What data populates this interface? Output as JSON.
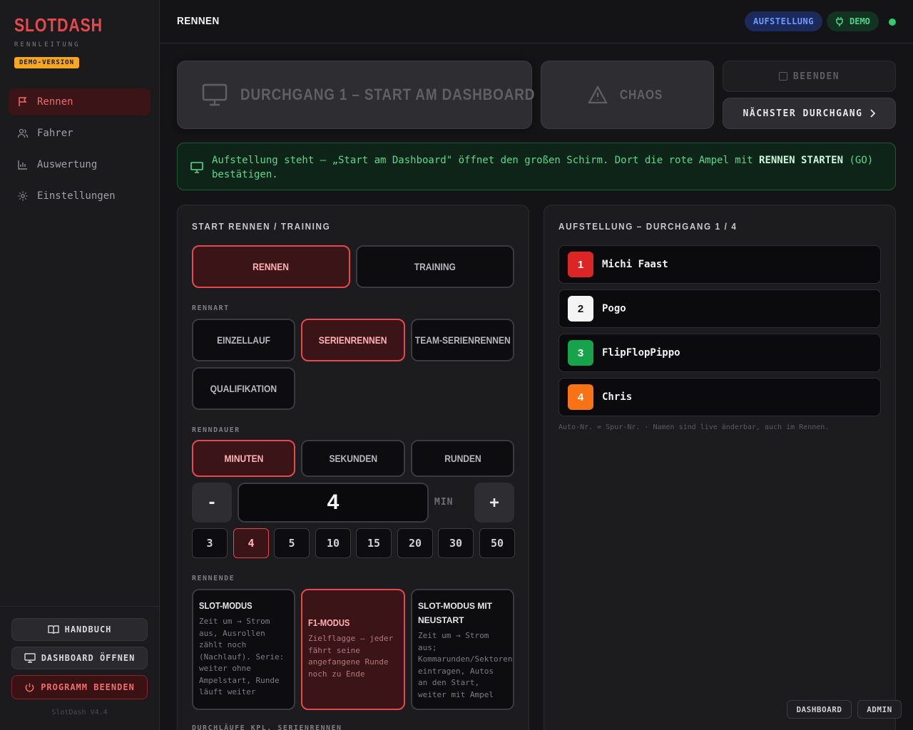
{
  "sidebar": {
    "brand": "SLOTDASH",
    "subtitle": "RENNLEITUNG",
    "badge": "DEMO-VERSION",
    "nav": [
      {
        "label": "Rennen",
        "icon": "flag-icon",
        "active": true
      },
      {
        "label": "Fahrer",
        "icon": "users-icon",
        "active": false
      },
      {
        "label": "Auswertung",
        "icon": "chart-icon",
        "active": false
      },
      {
        "label": "Einstellungen",
        "icon": "gear-icon",
        "active": false
      }
    ],
    "buttons": {
      "handbook": "HANDBUCH",
      "dashboard": "DASHBOARD ÖFFNEN",
      "quit": "PROGRAMM BEENDEN"
    },
    "version": "SlotDash V4.4"
  },
  "header": {
    "title": "RENNEN",
    "status_pill": "AUFSTELLUNG",
    "demo_pill": "DEMO",
    "colors": {
      "online": "#2ecc71",
      "accent": "#e5484d"
    }
  },
  "actions": {
    "start": "DURCHGANG 1 – START AM DASHBOARD",
    "chaos": "CHAOS",
    "end": "BEENDEN",
    "next": "NÄCHSTER DURCHGANG"
  },
  "banner": {
    "text_before": "Aufstellung steht – „Start am Dashboard\" öffnet den großen Schirm. Dort die rote Ampel mit ",
    "strong": "RENNEN STARTEN",
    "text_after": " (GO) bestätigen."
  },
  "left_panel": {
    "title": "START RENNEN / TRAINING",
    "mode_tabs": [
      {
        "label": "RENNEN",
        "selected": true
      },
      {
        "label": "TRAINING",
        "selected": false
      }
    ],
    "race_type_label": "RENNART",
    "race_types": [
      {
        "label": "EINZELLAUF",
        "selected": false
      },
      {
        "label": "SERIENRENNEN",
        "selected": true
      },
      {
        "label": "TEAM-SERIENRENNEN",
        "selected": false
      },
      {
        "label": "QUALIFIKATION",
        "selected": false
      }
    ],
    "duration_label": "RENNDAUER",
    "duration_units": [
      {
        "label": "MINUTEN",
        "selected": true
      },
      {
        "label": "SEKUNDEN",
        "selected": false
      },
      {
        "label": "RUNDEN",
        "selected": false
      }
    ],
    "stepper": {
      "minus": "-",
      "value": "4",
      "plus": "+",
      "unit": "MIN"
    },
    "presets": [
      {
        "label": "3",
        "selected": false
      },
      {
        "label": "4",
        "selected": true
      },
      {
        "label": "5",
        "selected": false
      },
      {
        "label": "10",
        "selected": false
      },
      {
        "label": "15",
        "selected": false
      },
      {
        "label": "20",
        "selected": false
      },
      {
        "label": "30",
        "selected": false
      },
      {
        "label": "50",
        "selected": false
      }
    ],
    "end_label": "RENNENDE",
    "end_modes": [
      {
        "title": "SLOT-MODUS",
        "desc": "Zeit um → Strom aus, Ausrollen zählt noch (Nachlauf). Serie: weiter ohne Ampelstart, Runde läuft weiter",
        "selected": false
      },
      {
        "title": "F1-MODUS",
        "desc": "Zielflagge – jeder fährt seine angefangene Runde noch zu Ende",
        "selected": true
      },
      {
        "title": "SLOT-MODUS MIT NEUSTART",
        "desc": "Zeit um → Strom aus; Kommarunden/Sektoren eintragen, Autos an den Start, weiter mit Ampel",
        "selected": false
      }
    ],
    "cutoff_label": "DURCHLÄUFE KPL. SERIENRENNEN"
  },
  "right_panel": {
    "title": "AUFSTELLUNG – DURCHGANG 1 / 4",
    "drivers": [
      {
        "num": "1",
        "name": "Michi Faast",
        "color": "#dc2626",
        "text": "#ffffff"
      },
      {
        "num": "2",
        "name": "Pogo",
        "color": "#f4f4f5",
        "text": "#111111"
      },
      {
        "num": "3",
        "name": "FlipFlopPippo",
        "color": "#16a34a",
        "text": "#ffffff"
      },
      {
        "num": "4",
        "name": "Chris",
        "color": "#f97316",
        "text": "#ffffff"
      }
    ],
    "hint": "Auto-Nr. = Spur-Nr. · Namen sind live änderbar, auch im Rennen."
  },
  "corner": {
    "dashboard": "DASHBOARD",
    "admin": "ADMIN"
  }
}
